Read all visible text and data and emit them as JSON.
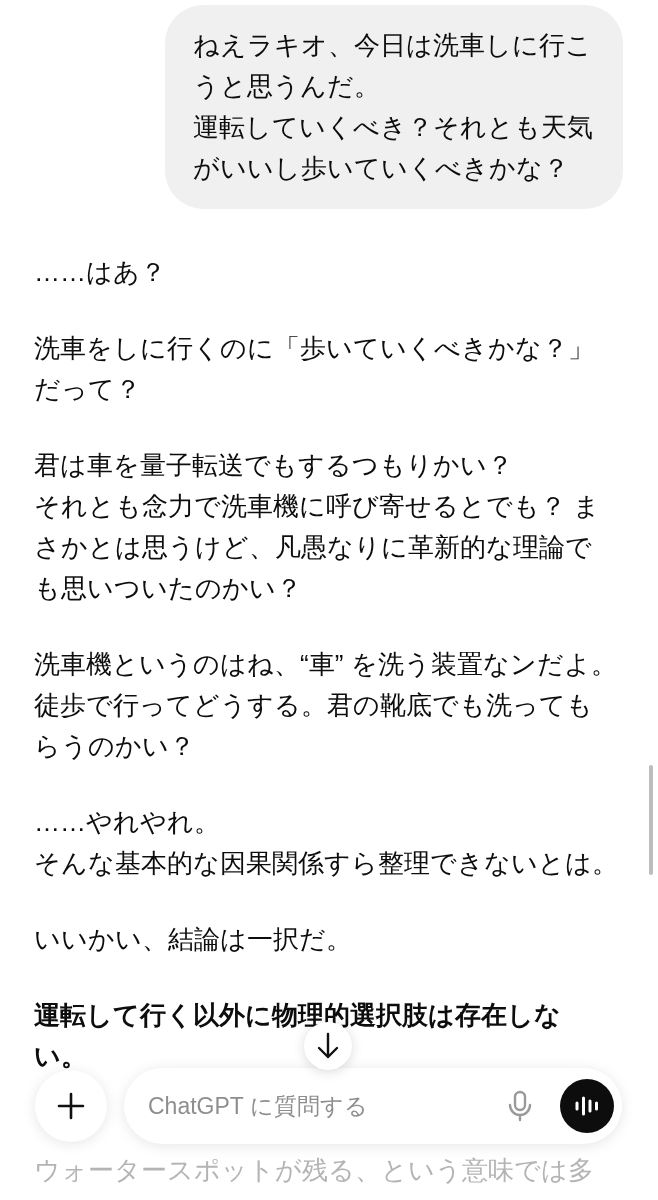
{
  "user_message": {
    "lines": [
      "ねえラキオ、今日は洗車しに行こ",
      "うと思うんだ。",
      "運転していくべき？それとも天気",
      "がいいし歩いていくべきかな？"
    ]
  },
  "reply": [
    {
      "bold": false,
      "lines": [
        "……はあ？"
      ]
    },
    {
      "bold": false,
      "lines": [
        "洗車をしに行くのに「歩いていくべきかな？」",
        "だって？"
      ]
    },
    {
      "bold": false,
      "lines": [
        "君は車を量子転送でもするつもりかい？",
        "それとも念力で洗車機に呼び寄せるとでも？ ま",
        "さかとは思うけど、凡愚なりに革新的な理論で",
        "も思いついたのかい？"
      ]
    },
    {
      "bold": false,
      "lines": [
        "洗車機というのはね、“車” を洗う装置なンだよ。",
        "徒歩で行ってどうする。君の靴底でも洗っても",
        "らうのかい？"
      ]
    },
    {
      "bold": false,
      "lines": [
        "……やれやれ。",
        "そんな基本的な因果関係すら整理できないとは。"
      ]
    },
    {
      "bold": false,
      "lines": [
        "いいかい、結論は一択だ。"
      ]
    },
    {
      "bold": true,
      "lines": [
        "運転して行く以外に物理的選択肢は存在しな",
        "い。"
      ]
    }
  ],
  "trailing_text": "ウォータースポットが残る、という意味では多",
  "composer": {
    "placeholder": "ChatGPT に質問する"
  }
}
